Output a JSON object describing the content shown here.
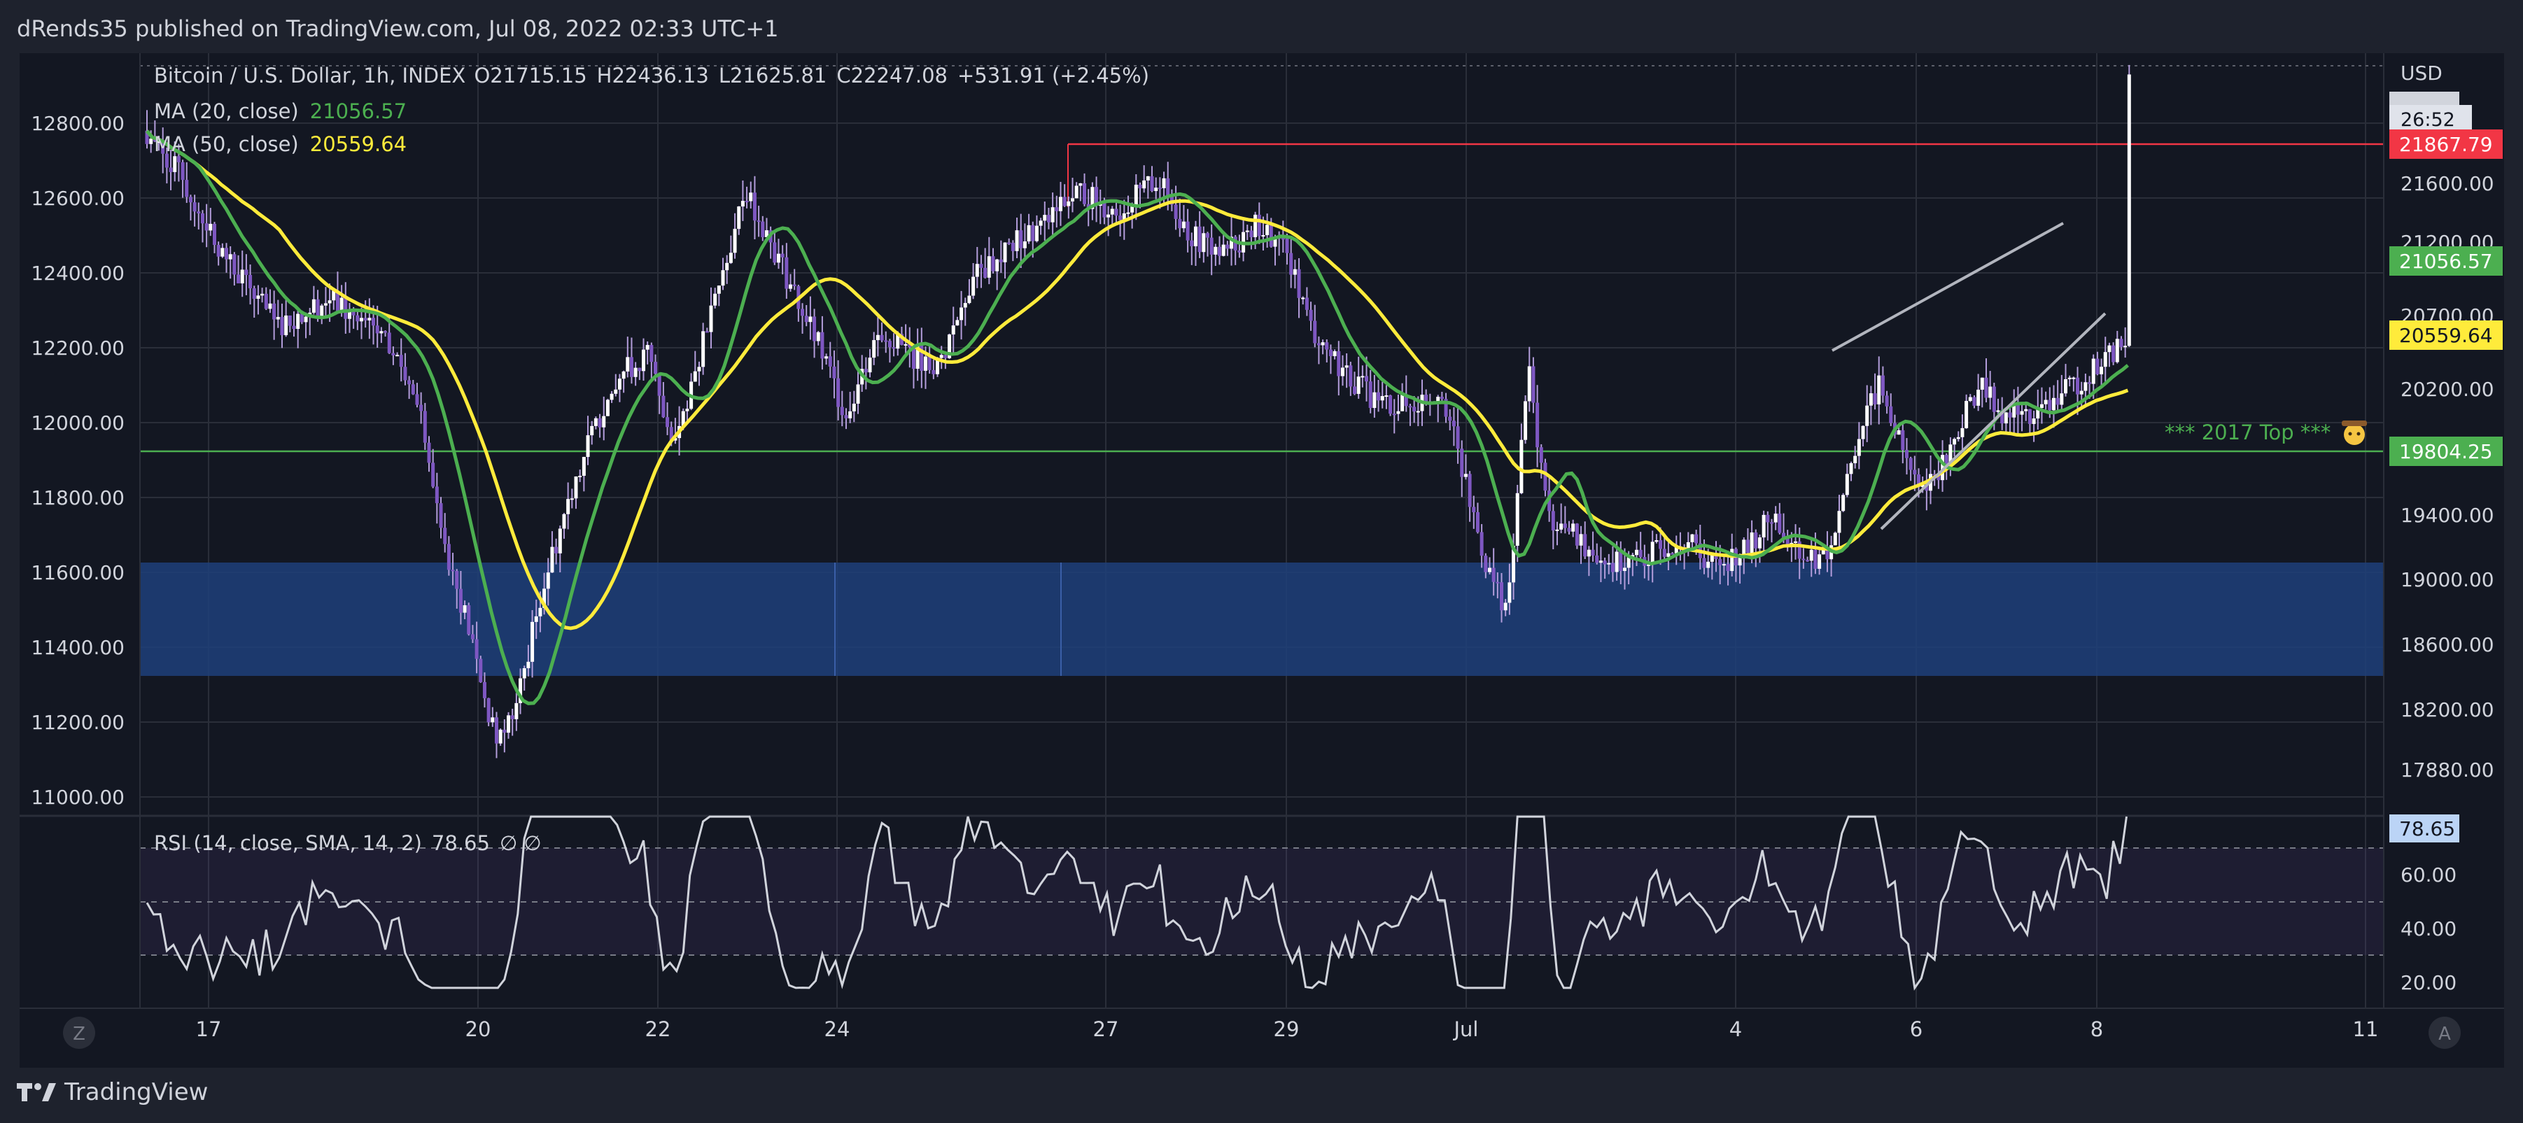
{
  "header": {
    "publisher_line": "dRends35 published on TradingView.com, Jul 08, 2022 02:33 UTC+1"
  },
  "footer": {
    "brand": "TradingView"
  },
  "chart_data": {
    "type": "candlestick",
    "symbol_line": "Bitcoin / U.S. Dollar, 1h, INDEX",
    "ohlc": {
      "open": "O21715.15",
      "high": "H22436.13",
      "low": "L21625.81",
      "close": "C22247.08",
      "change": "+531.91 (+2.45%)"
    },
    "indicators": [
      {
        "label": "MA (20, close)",
        "value": "21056.57",
        "color": "#4caf50"
      },
      {
        "label": "MA (50, close)",
        "value": "20559.64",
        "color": "#ffeb3b"
      }
    ],
    "currency": "USD",
    "bar_countdown": "26:52",
    "left_axis_ticks": [
      "12800.00",
      "12600.00",
      "12400.00",
      "12200.00",
      "12000.00",
      "11800.00",
      "11600.00",
      "11400.00",
      "11200.00",
      "11000.00"
    ],
    "right_axis_ticks": [
      "21600.00",
      "21200.00",
      "20700.00",
      "20200.00",
      "19400.00",
      "19000.00",
      "18600.00",
      "18200.00",
      "17880.00"
    ],
    "price_labels": [
      {
        "value": "21867.79",
        "color": "#f23645"
      },
      {
        "value": "21056.57",
        "color": "#4caf50"
      },
      {
        "value": "20559.64",
        "color": "#ffeb3b"
      },
      {
        "value": "19804.25",
        "color": "#4caf50"
      }
    ],
    "annotation": "*** 2017 Top ***",
    "x_ticks": [
      "17",
      "20",
      "22",
      "24",
      "27",
      "29",
      "Jul",
      "4",
      "6",
      "8",
      "11"
    ],
    "rsi": {
      "label": "RSI (14, close, SMA, 14, 2)",
      "value": "78.65",
      "extra": "∅  ∅",
      "ticks": [
        "60.00",
        "40.00",
        "20.00"
      ]
    },
    "scale_buttons": {
      "left": "Z",
      "right": "A"
    }
  }
}
